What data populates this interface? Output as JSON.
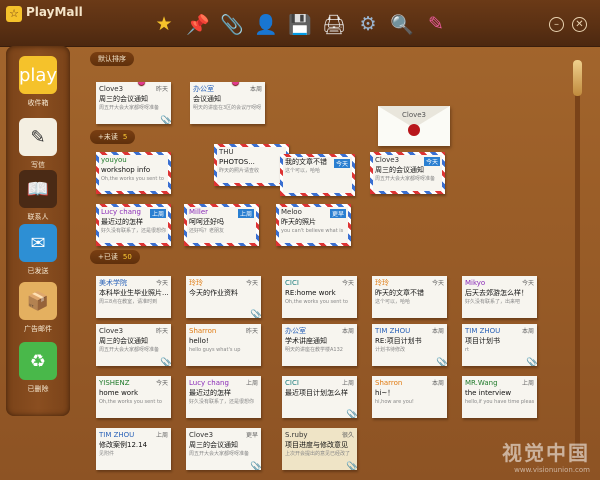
{
  "app": {
    "title": "PlayMall",
    "logo_text": "☆"
  },
  "toolbar": [
    {
      "name": "star-icon",
      "glyph": "★",
      "color": "#f5c22b"
    },
    {
      "name": "pushpin-icon",
      "glyph": "📌",
      "color": "#e23b8e"
    },
    {
      "name": "paperclip-icon",
      "glyph": "📎",
      "color": "#e05a2a"
    },
    {
      "name": "user-icon",
      "glyph": "👤",
      "color": "#5aa0e0"
    },
    {
      "name": "save-icon",
      "glyph": "💾",
      "color": "#3a7fd1"
    },
    {
      "name": "print-icon",
      "glyph": "🖨",
      "color": "#eeeeee"
    },
    {
      "name": "gear-icon",
      "glyph": "⚙",
      "color": "#9ab4cf"
    },
    {
      "name": "search-icon",
      "glyph": "🔍",
      "color": "#e0e0e0"
    },
    {
      "name": "edit-icon",
      "glyph": "✎",
      "color": "#e85a9a"
    }
  ],
  "window_buttons": {
    "minimize": "–",
    "close": "✕"
  },
  "sidebar": [
    {
      "name": "sidebar-item-inbox",
      "label": "收件箱",
      "icon": "play",
      "bg": "#f5c22b",
      "fg": "#fff"
    },
    {
      "name": "sidebar-item-compose",
      "label": "写信",
      "icon": "✎",
      "bg": "#f4efe2",
      "fg": "#333"
    },
    {
      "name": "sidebar-item-contacts",
      "label": "联系人",
      "icon": "📖",
      "bg": "#4a2a15",
      "fg": "#fff"
    },
    {
      "name": "sidebar-item-sent",
      "label": "已发送",
      "icon": "✉",
      "bg": "#2d8fd4",
      "fg": "#fff"
    },
    {
      "name": "sidebar-item-ads",
      "label": "广告邮件",
      "icon": "📦",
      "bg": "#e4b060",
      "fg": "#7a3b12"
    },
    {
      "name": "sidebar-item-deleted",
      "label": "已删除",
      "icon": "♻",
      "bg": "#49b84a",
      "fg": "#fff"
    }
  ],
  "sections": {
    "sort": {
      "label": "默认排序",
      "count": ""
    },
    "unread": {
      "label": "+未读",
      "count": "5"
    },
    "read": {
      "label": "+已读",
      "count": "50"
    }
  },
  "pinned": [
    {
      "from": "Clove3",
      "from_color": "dark",
      "date": "昨天",
      "subject": "周三的会议通知",
      "preview": "周五开大会大家都呀呀准备",
      "clip": true
    },
    {
      "from": "办公室",
      "from_color": "blue",
      "date": "本周",
      "subject": "会议通知",
      "preview": "明天的讲座在3区的会议厅呀呀",
      "clip": false
    }
  ],
  "unread": [
    {
      "from": "youyou",
      "from_color": "green",
      "date": "",
      "subject": "workshop info",
      "preview": "Oh,the works you sent to"
    },
    {
      "from": "THU",
      "from_color": "dark",
      "date": "",
      "subject": "PHOTOS...",
      "preview": "昨天的照片请查收"
    },
    {
      "from": "",
      "from_color": "dark",
      "date": "今天",
      "subject": "我的文章不错",
      "preview": "这个可以，哈哈"
    },
    {
      "from": "Clove3",
      "from_color": "dark",
      "date": "今天",
      "subject": "周三的会议通知",
      "preview": "周五开大会大家都呀呀准备"
    },
    {
      "from": "Lucy chang",
      "from_color": "purple",
      "date": "上周",
      "subject": "最近过的怎样",
      "preview": "好久没有联系了，还是很想你"
    },
    {
      "from": "Miller",
      "from_color": "purple",
      "date": "上周",
      "subject": "呵呵还好吗",
      "preview": "还好吗？老朋友"
    },
    {
      "from": "Meloo",
      "from_color": "dark",
      "date": "更早",
      "subject": "昨天的照片",
      "preview": "you can't believe what is"
    }
  ],
  "envelope": {
    "from": "Clove3"
  },
  "read": [
    {
      "from": "美术学院",
      "from_color": "blue",
      "date": "今天",
      "subject": "本科毕业生毕业照片...",
      "preview": "周三8点在教室，请准时到",
      "clip": false
    },
    {
      "from": "玲玲",
      "from_color": "orange",
      "date": "今天",
      "subject": "今天的作业资料",
      "preview": "",
      "clip": true
    },
    {
      "from": "CICI",
      "from_color": "teal",
      "date": "今天",
      "subject": "RE:home work",
      "preview": "Oh,the works you sent to",
      "clip": false
    },
    {
      "from": "玲玲",
      "from_color": "orange",
      "date": "今天",
      "subject": "昨天的文章不错",
      "preview": "这个可以，哈哈",
      "clip": false
    },
    {
      "from": "Mikyo",
      "from_color": "purple",
      "date": "今天",
      "subject": "后天去郊游怎么样！",
      "preview": "好久没有联系了，出来吧",
      "clip": false
    },
    {
      "from": "Clove3",
      "from_color": "dark",
      "date": "昨天",
      "subject": "周三的会议通知",
      "preview": "周五开大会大家都呀呀准备",
      "clip": true
    },
    {
      "from": "Sharron",
      "from_color": "orange",
      "date": "昨天",
      "subject": "hello!",
      "preview": "hello guys what's up",
      "clip": false
    },
    {
      "from": "办公室",
      "from_color": "blue",
      "date": "本周",
      "subject": "学术讲座通知",
      "preview": "明天的讲座在教学楼A132",
      "clip": false
    },
    {
      "from": "TIM ZHOU",
      "from_color": "blue",
      "date": "本周",
      "subject": "RE:项目计划书",
      "preview": "计划书待修改",
      "clip": true
    },
    {
      "from": "TIM ZHOU",
      "from_color": "blue",
      "date": "本周",
      "subject": "项目计划书",
      "preview": "rt",
      "clip": true
    },
    {
      "from": "YISHENZ",
      "from_color": "green",
      "date": "今天",
      "subject": "home work",
      "preview": "Oh,the works you sent to",
      "clip": false
    },
    {
      "from": "Lucy chang",
      "from_color": "purple",
      "date": "上周",
      "subject": "最近过的怎样",
      "preview": "好久没有联系了，还是很想你",
      "clip": false
    },
    {
      "from": "CICI",
      "from_color": "teal",
      "date": "上周",
      "subject": "最近项目计划怎么样",
      "preview": "",
      "clip": true
    },
    {
      "from": "Sharron",
      "from_color": "orange",
      "date": "本周",
      "subject": "hi~！",
      "preview": "hi,how are you!",
      "clip": false
    },
    {
      "from": "MR.Wang",
      "from_color": "green",
      "date": "上周",
      "subject": "the interview",
      "preview": "hello,if you have time pleas",
      "clip": false
    },
    {
      "from": "TIM ZHOU",
      "from_color": "blue",
      "date": "上周",
      "subject": "修改案例12.14",
      "preview": "见附件",
      "clip": false
    },
    {
      "from": "Clove3",
      "from_color": "dark",
      "date": "更早",
      "subject": "周三的会议通知",
      "preview": "周五开大会大家都呀呀准备",
      "clip": true
    },
    {
      "from": "S.ruby",
      "from_color": "dark",
      "date": "很久",
      "subject": "项目进度与修改意见",
      "preview": "上次开会提出的意见已经改了",
      "clip": true
    }
  ],
  "watermark": {
    "line1": "视觉中国",
    "line2": "www.visionunion.com"
  }
}
